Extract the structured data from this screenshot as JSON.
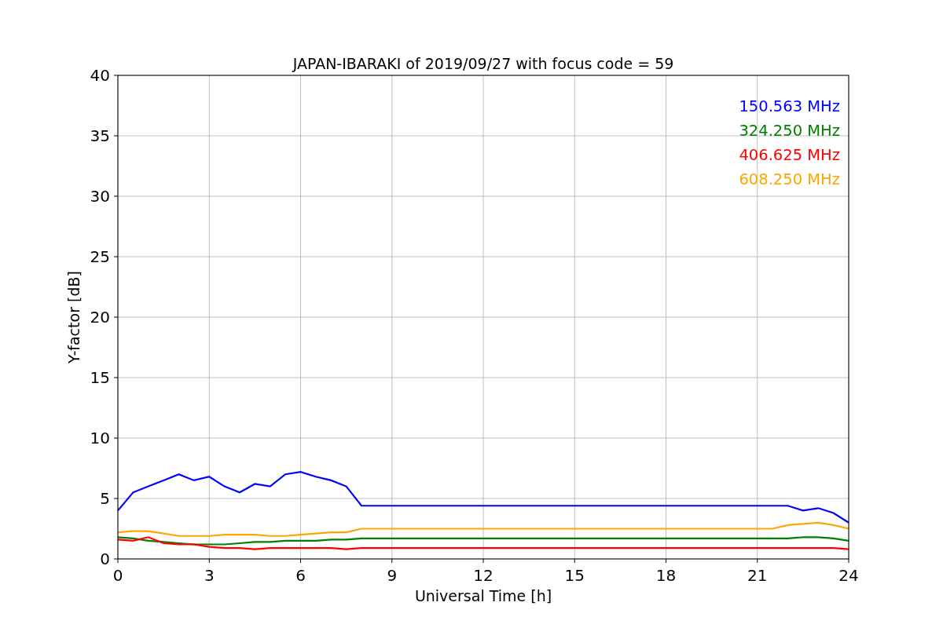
{
  "figure": {
    "chart_data": {
      "type": "line",
      "title": "JAPAN-IBARAKI of 2019/09/27 with focus code = 59",
      "xlabel": "Universal Time [h]",
      "ylabel": "Y-factor [dB]",
      "x": [
        0,
        0.5,
        1,
        1.5,
        2,
        2.5,
        3,
        3.5,
        4,
        4.5,
        5,
        5.5,
        6,
        6.5,
        7,
        7.5,
        8,
        8.5,
        9,
        9.5,
        10,
        10.5,
        11,
        11.5,
        12,
        12.5,
        13,
        13.5,
        14,
        14.5,
        15,
        15.5,
        16,
        16.5,
        17,
        17.5,
        18,
        18.5,
        19,
        19.5,
        20,
        20.5,
        21,
        21.5,
        22,
        22.5,
        23,
        23.5,
        24
      ],
      "series": [
        {
          "name": "150.563 MHz",
          "color": "#0000ff",
          "values": [
            4,
            5.5,
            6,
            6.5,
            7,
            6.5,
            6.8,
            6,
            5.5,
            6.2,
            6,
            7,
            7.2,
            6.8,
            6.5,
            6,
            4.4,
            4.4,
            4.4,
            4.4,
            4.4,
            4.4,
            4.4,
            4.4,
            4.4,
            4.4,
            4.4,
            4.4,
            4.4,
            4.4,
            4.4,
            4.4,
            4.4,
            4.4,
            4.4,
            4.4,
            4.4,
            4.4,
            4.4,
            4.4,
            4.4,
            4.4,
            4.4,
            4.4,
            4.4,
            4,
            4.2,
            3.8,
            3
          ]
        },
        {
          "name": "324.250 MHz",
          "color": "#008000",
          "values": [
            1.8,
            1.7,
            1.5,
            1.4,
            1.3,
            1.2,
            1.2,
            1.2,
            1.3,
            1.4,
            1.4,
            1.5,
            1.5,
            1.5,
            1.6,
            1.6,
            1.7,
            1.7,
            1.7,
            1.7,
            1.7,
            1.7,
            1.7,
            1.7,
            1.7,
            1.7,
            1.7,
            1.7,
            1.7,
            1.7,
            1.7,
            1.7,
            1.7,
            1.7,
            1.7,
            1.7,
            1.7,
            1.7,
            1.7,
            1.7,
            1.7,
            1.7,
            1.7,
            1.7,
            1.7,
            1.8,
            1.8,
            1.7,
            1.5
          ]
        },
        {
          "name": "406.625 MHz",
          "color": "#ff0000",
          "values": [
            1.6,
            1.5,
            1.8,
            1.3,
            1.2,
            1.2,
            1,
            0.9,
            0.9,
            0.8,
            0.9,
            0.9,
            0.9,
            0.9,
            0.9,
            0.8,
            0.9,
            0.9,
            0.9,
            0.9,
            0.9,
            0.9,
            0.9,
            0.9,
            0.9,
            0.9,
            0.9,
            0.9,
            0.9,
            0.9,
            0.9,
            0.9,
            0.9,
            0.9,
            0.9,
            0.9,
            0.9,
            0.9,
            0.9,
            0.9,
            0.9,
            0.9,
            0.9,
            0.9,
            0.9,
            0.9,
            0.9,
            0.9,
            0.8
          ]
        },
        {
          "name": "608.250 MHz",
          "color": "#ffa500",
          "values": [
            2.2,
            2.3,
            2.3,
            2.1,
            1.9,
            1.9,
            1.9,
            2,
            2,
            2,
            1.9,
            1.9,
            2,
            2.1,
            2.2,
            2.2,
            2.5,
            2.5,
            2.5,
            2.5,
            2.5,
            2.5,
            2.5,
            2.5,
            2.5,
            2.5,
            2.5,
            2.5,
            2.5,
            2.5,
            2.5,
            2.5,
            2.5,
            2.5,
            2.5,
            2.5,
            2.5,
            2.5,
            2.5,
            2.5,
            2.5,
            2.5,
            2.5,
            2.5,
            2.8,
            2.9,
            3,
            2.8,
            2.5
          ]
        }
      ],
      "grid": true,
      "xlim": [
        0,
        24
      ],
      "ylim": [
        0,
        40
      ],
      "xticks": [
        0,
        3,
        6,
        9,
        12,
        15,
        18,
        21,
        24
      ],
      "yticks": [
        0,
        5,
        10,
        15,
        20,
        25,
        30,
        35,
        40
      ]
    }
  }
}
